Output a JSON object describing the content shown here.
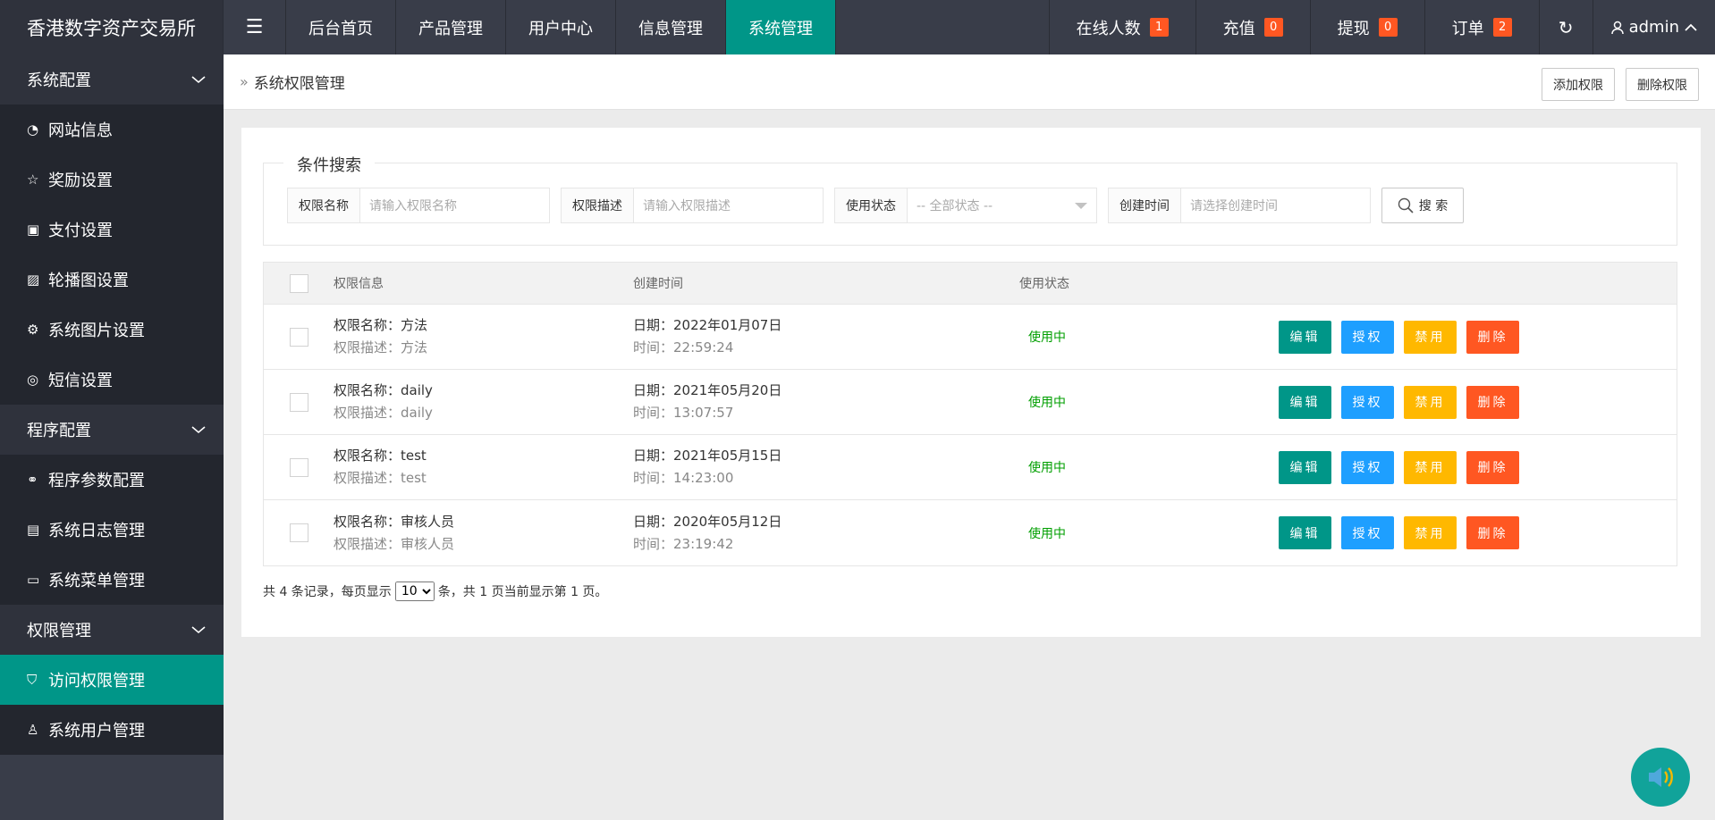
{
  "header": {
    "logo": "香港数字资产交易所",
    "nav": [
      {
        "label": "后台首页"
      },
      {
        "label": "产品管理"
      },
      {
        "label": "用户中心"
      },
      {
        "label": "信息管理"
      },
      {
        "label": "系统管理"
      }
    ],
    "active_nav": "系统管理",
    "stats": [
      {
        "label": "在线人数",
        "count": "1"
      },
      {
        "label": "充值",
        "count": "0"
      },
      {
        "label": "提现",
        "count": "0"
      },
      {
        "label": "订单",
        "count": "2"
      }
    ],
    "user": "admin",
    "icons": {
      "menu": "hamburger-icon",
      "refresh": "refresh-icon",
      "user": "user-icon"
    }
  },
  "sidebar": {
    "sections": [
      {
        "title": "系统配置",
        "items": [
          {
            "label": "网站信息",
            "icon": "dashboard-icon"
          },
          {
            "label": "奖励设置",
            "icon": "star-icon"
          },
          {
            "label": "支付设置",
            "icon": "money-icon"
          },
          {
            "label": "轮播图设置",
            "icon": "image-icon"
          },
          {
            "label": "系统图片设置",
            "icon": "gear-icon"
          },
          {
            "label": "短信设置",
            "icon": "message-icon"
          }
        ]
      },
      {
        "title": "程序配置",
        "items": [
          {
            "label": "程序参数配置",
            "icon": "link-icon"
          },
          {
            "label": "系统日志管理",
            "icon": "clipboard-icon"
          },
          {
            "label": "系统菜单管理",
            "icon": "window-icon"
          }
        ]
      },
      {
        "title": "权限管理",
        "items": [
          {
            "label": "访问权限管理",
            "icon": "shield-icon"
          },
          {
            "label": "系统用户管理",
            "icon": "user-icon"
          }
        ]
      }
    ],
    "active_item": "访问权限管理"
  },
  "page": {
    "title": "系统权限管理",
    "actions": {
      "add": "添加权限",
      "delete": "删除权限"
    }
  },
  "search": {
    "legend": "条件搜索",
    "fields": [
      {
        "label": "权限名称",
        "placeholder": "请输入权限名称"
      },
      {
        "label": "权限描述",
        "placeholder": "请输入权限描述"
      },
      {
        "label": "使用状态",
        "placeholder": "-- 全部状态 --"
      },
      {
        "label": "创建时间",
        "placeholder": "请选择创建时间"
      }
    ],
    "button": "搜 索"
  },
  "table": {
    "columns": {
      "info": "权限信息",
      "time": "创建时间",
      "status": "使用状态"
    },
    "rows": [
      {
        "name": "权限名称：方法",
        "desc": "权限描述：方法",
        "date": "日期：2022年01月07日",
        "time": "时间：22:59:24",
        "status": "使用中"
      },
      {
        "name": "权限名称：daily",
        "desc": "权限描述：daily",
        "date": "日期：2021年05月20日",
        "time": "时间：13:07:57",
        "status": "使用中"
      },
      {
        "name": "权限名称：test",
        "desc": "权限描述：test",
        "date": "日期：2021年05月15日",
        "time": "时间：14:23:00",
        "status": "使用中"
      },
      {
        "name": "权限名称：审核人员",
        "desc": "权限描述：审核人员",
        "date": "日期：2020年05月12日",
        "time": "时间：23:19:42",
        "status": "使用中"
      }
    ],
    "ops": {
      "edit": "编辑",
      "auth": "授权",
      "disable": "禁用",
      "delete": "删除"
    }
  },
  "pager": {
    "prefix": "共 4 条记录，每页显示",
    "per_page": "10",
    "suffix": "条，共 1 页当前显示第 1 页。"
  },
  "colors": {
    "accent": "#009688",
    "blue": "#1e9fff",
    "warn": "#ffb800",
    "danger": "#ff5722",
    "dark": "#393d49"
  }
}
